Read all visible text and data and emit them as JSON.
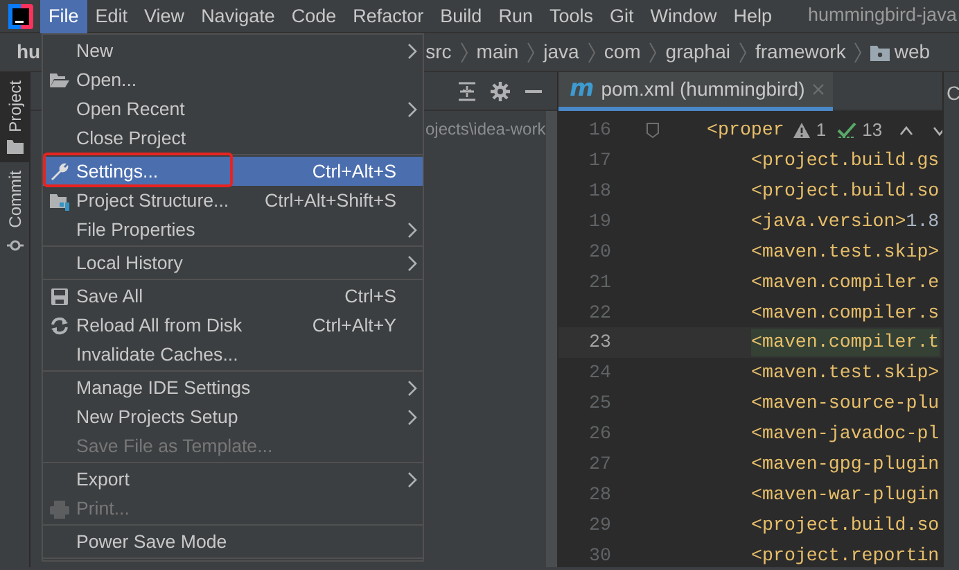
{
  "menubar": {
    "items": [
      {
        "label": "File",
        "selected": true
      },
      {
        "label": "Edit",
        "selected": false
      },
      {
        "label": "View",
        "selected": false
      },
      {
        "label": "Navigate",
        "selected": false
      },
      {
        "label": "Code",
        "selected": false
      },
      {
        "label": "Refactor",
        "selected": false
      },
      {
        "label": "Build",
        "selected": false
      },
      {
        "label": "Run",
        "selected": false
      },
      {
        "label": "Tools",
        "selected": false
      },
      {
        "label": "Git",
        "selected": false
      },
      {
        "label": "Window",
        "selected": false
      },
      {
        "label": "Help",
        "selected": false
      }
    ],
    "window_title": "hummingbird-java"
  },
  "breadcrumb": {
    "project": "hu",
    "segments": [
      "src",
      "main",
      "java",
      "com",
      "graphai",
      "framework",
      "web"
    ]
  },
  "tool_stripe": [
    {
      "label": "Project",
      "selected": true
    },
    {
      "label": "Commit",
      "selected": false
    }
  ],
  "project_panel": {
    "path": "ojects\\idea-work"
  },
  "editor": {
    "tab": {
      "icon_glyph": "m",
      "label": "pom.xml (hummingbird)",
      "selected": true
    },
    "inspections": {
      "warnings": "1",
      "checks": "13"
    },
    "lines": [
      {
        "number": "16",
        "kind": "parent",
        "tag": "<proper",
        "current": false
      },
      {
        "number": "17",
        "kind": "child",
        "tag": "<project.build.gs",
        "current": false
      },
      {
        "number": "18",
        "kind": "child",
        "tag": "<project.build.so",
        "current": false
      },
      {
        "number": "19",
        "kind": "child",
        "tag": "<java.version>",
        "value": "1.8",
        "current": false
      },
      {
        "number": "20",
        "kind": "child",
        "tag": "<maven.test.skip>",
        "current": false
      },
      {
        "number": "21",
        "kind": "child",
        "tag": "<maven.compiler.e",
        "current": false
      },
      {
        "number": "22",
        "kind": "child",
        "tag": "<maven.compiler.s",
        "current": false
      },
      {
        "number": "23",
        "kind": "child",
        "tag": "<maven.compiler.t",
        "current": true
      },
      {
        "number": "24",
        "kind": "child",
        "tag": "<maven.test.skip>",
        "current": false
      },
      {
        "number": "25",
        "kind": "child",
        "tag": "<maven-source-plu",
        "current": false
      },
      {
        "number": "26",
        "kind": "child",
        "tag": "<maven-javadoc-pl",
        "current": false
      },
      {
        "number": "27",
        "kind": "child",
        "tag": "<maven-gpg-plugin",
        "current": false
      },
      {
        "number": "28",
        "kind": "child",
        "tag": "<maven-war-plugin",
        "current": false
      },
      {
        "number": "29",
        "kind": "child",
        "tag": "<project.build.so",
        "current": false
      },
      {
        "number": "30",
        "kind": "child",
        "tag": "<project.reportin",
        "current": false
      }
    ]
  },
  "right_panel": {
    "tab_label": "C"
  },
  "file_menu": {
    "items": [
      {
        "kind": "item",
        "label": "New",
        "submenu": true,
        "selected": false,
        "disabled": false,
        "outlined": false
      },
      {
        "kind": "item",
        "label": "Open...",
        "submenu": false,
        "selected": false,
        "disabled": false,
        "outlined": false
      },
      {
        "kind": "item",
        "label": "Open Recent",
        "submenu": true,
        "selected": false,
        "disabled": false,
        "outlined": false
      },
      {
        "kind": "item",
        "label": "Close Project",
        "submenu": false,
        "selected": false,
        "disabled": false,
        "outlined": false
      },
      {
        "kind": "separator"
      },
      {
        "kind": "item",
        "label": "Settings...",
        "shortcut": "Ctrl+Alt+S",
        "submenu": false,
        "selected": true,
        "disabled": false,
        "outlined": true
      },
      {
        "kind": "item",
        "label": "Project Structure...",
        "shortcut": "Ctrl+Alt+Shift+S",
        "submenu": false,
        "selected": false,
        "disabled": false,
        "outlined": false
      },
      {
        "kind": "item",
        "label": "File Properties",
        "submenu": true,
        "selected": false,
        "disabled": false,
        "outlined": false
      },
      {
        "kind": "separator"
      },
      {
        "kind": "item",
        "label": "Local History",
        "submenu": true,
        "selected": false,
        "disabled": false,
        "outlined": false
      },
      {
        "kind": "separator"
      },
      {
        "kind": "item",
        "label": "Save All",
        "shortcut": "Ctrl+S",
        "submenu": false,
        "selected": false,
        "disabled": false,
        "outlined": false
      },
      {
        "kind": "item",
        "label": "Reload All from Disk",
        "shortcut": "Ctrl+Alt+Y",
        "submenu": false,
        "selected": false,
        "disabled": false,
        "outlined": false
      },
      {
        "kind": "item",
        "label": "Invalidate Caches...",
        "submenu": false,
        "selected": false,
        "disabled": false,
        "outlined": false
      },
      {
        "kind": "separator"
      },
      {
        "kind": "item",
        "label": "Manage IDE Settings",
        "submenu": true,
        "selected": false,
        "disabled": false,
        "outlined": false
      },
      {
        "kind": "item",
        "label": "New Projects Setup",
        "submenu": true,
        "selected": false,
        "disabled": false,
        "outlined": false
      },
      {
        "kind": "item",
        "label": "Save File as Template...",
        "submenu": false,
        "selected": false,
        "disabled": true,
        "outlined": false
      },
      {
        "kind": "separator"
      },
      {
        "kind": "item",
        "label": "Export",
        "submenu": true,
        "selected": false,
        "disabled": false,
        "outlined": false
      },
      {
        "kind": "item",
        "label": "Print...",
        "submenu": false,
        "selected": false,
        "disabled": true,
        "outlined": false
      },
      {
        "kind": "separator"
      },
      {
        "kind": "item",
        "label": "Power Save Mode",
        "submenu": false,
        "selected": false,
        "disabled": false,
        "outlined": false
      },
      {
        "kind": "separator"
      }
    ]
  }
}
